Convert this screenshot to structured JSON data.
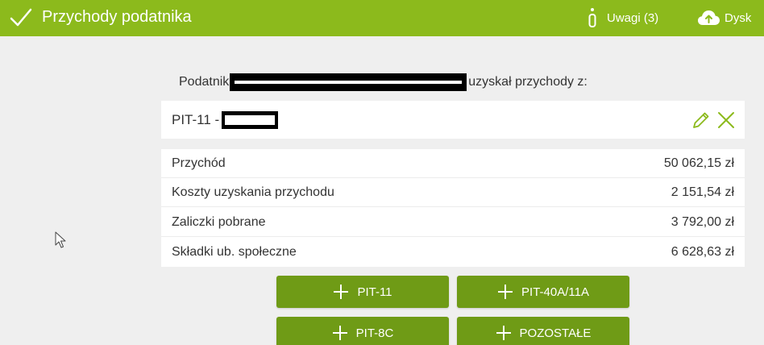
{
  "header": {
    "title": "Przychody podatnika",
    "notes_label": "Uwagi (3)",
    "drive_label": "Dysk"
  },
  "intro": {
    "prefix": "Podatnik",
    "suffix": "uzyskał przychody z:"
  },
  "card": {
    "title": "PIT-11 -"
  },
  "table": {
    "rows": [
      {
        "label": "Przychód",
        "value": "50 062,15 zł"
      },
      {
        "label": "Koszty uzyskania przychodu",
        "value": "2 151,54 zł"
      },
      {
        "label": "Zaliczki pobrane",
        "value": "3 792,00 zł"
      },
      {
        "label": "Składki ub. społeczne",
        "value": "6 628,63 zł"
      }
    ]
  },
  "buttons": {
    "pit11": "PIT-11",
    "pit40a": "PIT-40A/11A",
    "pit8c": "PIT-8C",
    "other": "POZOSTAŁE"
  },
  "colors": {
    "header_bg": "#8cba1c",
    "button_bg": "#6f9b16",
    "icon_green": "#8cba1c"
  }
}
